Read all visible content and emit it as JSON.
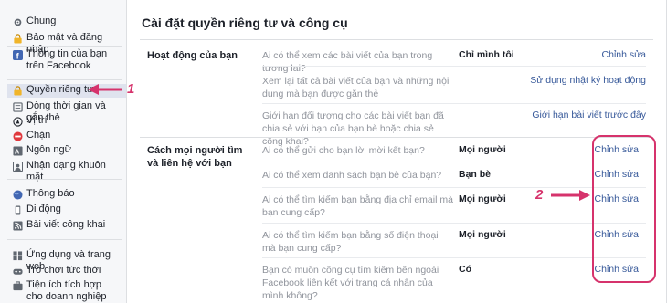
{
  "sidebar": {
    "items": [
      {
        "label": "Chung",
        "icon": "gear-icon"
      },
      {
        "label": "Bảo mật và đăng nhập",
        "icon": "lock-icon"
      },
      {
        "label": "Thông tin của bạn trên Facebook",
        "icon": "facebook-icon"
      },
      {
        "label": "Quyền riêng tư",
        "icon": "privacy-lock-icon"
      },
      {
        "label": "Dòng thời gian và gắn thẻ",
        "icon": "timeline-icon"
      },
      {
        "label": "Vị trí",
        "icon": "location-icon"
      },
      {
        "label": "Chặn",
        "icon": "block-icon"
      },
      {
        "label": "Ngôn ngữ",
        "icon": "language-icon"
      },
      {
        "label": "Nhận dạng khuôn mặt",
        "icon": "face-recognition-icon"
      },
      {
        "label": "Thông báo",
        "icon": "globe-icon"
      },
      {
        "label": "Di động",
        "icon": "mobile-icon"
      },
      {
        "label": "Bài viết công khai",
        "icon": "rss-icon"
      },
      {
        "label": "Ứng dụng và trang web",
        "icon": "apps-icon"
      },
      {
        "label": "Trò chơi tức thời",
        "icon": "gamepad-icon"
      },
      {
        "label": "Tiện ích tích hợp cho doanh nghiệp",
        "icon": "business-icon"
      }
    ]
  },
  "main": {
    "title": "Cài đặt quyền riêng tư và công cụ",
    "sections": [
      {
        "label": "Hoạt động của bạn",
        "rows": [
          {
            "question": "Ai có thể xem các bài viết của bạn trong tương lai?",
            "value": "Chỉ mình tôi",
            "action": "Chỉnh sửa"
          },
          {
            "question": "Xem lại tất cả bài viết của bạn và những nội dung mà bạn được gắn thẻ",
            "value": "",
            "action": "Sử dụng nhật ký hoạt động"
          },
          {
            "question": "Giới hạn đối tượng cho các bài viết bạn đã chia sẻ với bạn của bạn bè hoặc chia sẻ công khai?",
            "value": "",
            "action": "Giới hạn bài viết trước đây"
          }
        ]
      },
      {
        "label": "Cách mọi người tìm và liên hệ với bạn",
        "rows": [
          {
            "question": "Ai có thể gửi cho bạn lời mời kết bạn?",
            "value": "Mọi người",
            "action": "Chỉnh sửa"
          },
          {
            "question": "Ai có thể xem danh sách bạn bè của bạn?",
            "value": "Bạn bè",
            "action": "Chỉnh sửa"
          },
          {
            "question": "Ai có thể tìm kiếm bạn bằng địa chỉ email mà bạn cung cấp?",
            "value": "Mọi người",
            "action": "Chỉnh sửa"
          },
          {
            "question": "Ai có thể tìm kiếm bạn bằng số điện thoại mà bạn cung cấp?",
            "value": "Mọi người",
            "action": "Chỉnh sửa"
          },
          {
            "question": "Bạn có muốn công cụ tìm kiếm bên ngoài Facebook liên kết với trang cá nhân của mình không?",
            "value": "Có",
            "action": "Chỉnh sửa"
          }
        ]
      }
    ]
  },
  "annotations": {
    "step1": "1",
    "step2": "2",
    "color": "#d6336c"
  }
}
